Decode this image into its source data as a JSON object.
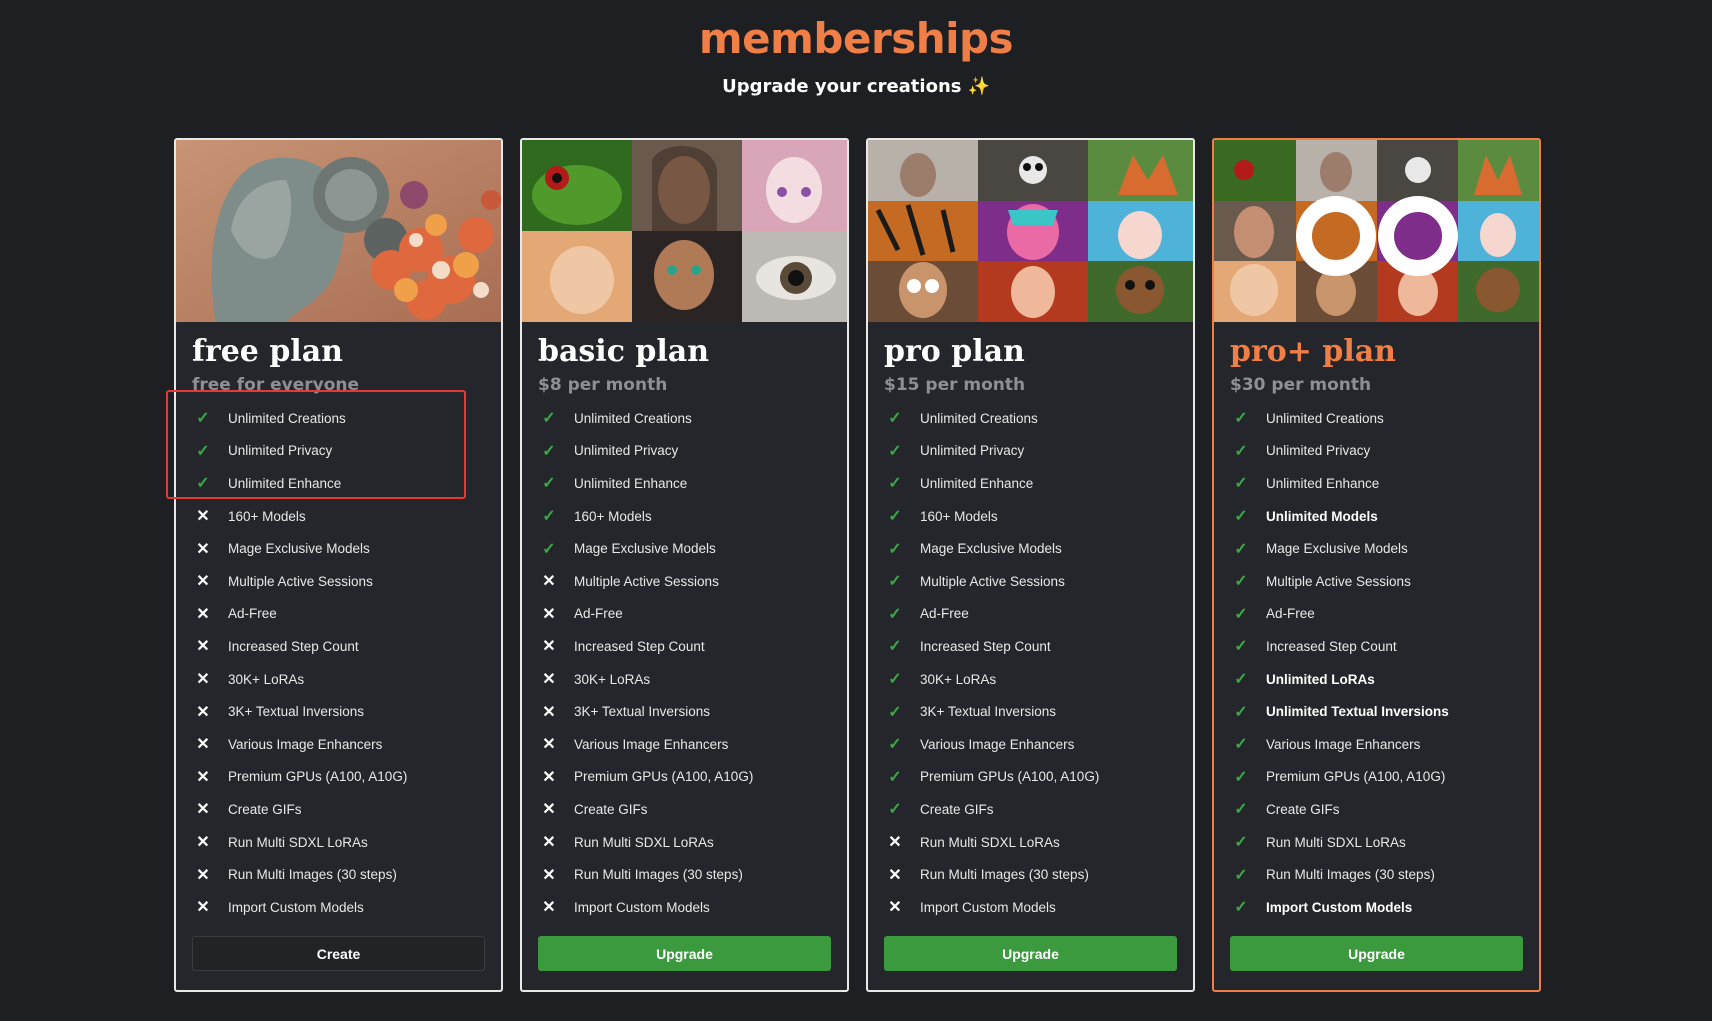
{
  "header": {
    "title": "memberships",
    "subtitle": "Upgrade your creations",
    "sparkle": "✨"
  },
  "colors": {
    "accent": "#ef7f47",
    "check": "#3aa846",
    "button_green": "#3c9a3e",
    "background": "#1e1f22",
    "card": "#25262b",
    "annotation": "#e53935"
  },
  "icons": {
    "check": "check-icon",
    "cross": "x-icon"
  },
  "plans": [
    {
      "name": "free plan",
      "price": "free for everyone",
      "button": "Create",
      "features": [
        {
          "label": "Unlimited Creations",
          "included": true,
          "bold": false
        },
        {
          "label": "Unlimited Privacy",
          "included": true,
          "bold": false
        },
        {
          "label": "Unlimited Enhance",
          "included": true,
          "bold": false
        },
        {
          "label": "160+ Models",
          "included": false,
          "bold": false
        },
        {
          "label": "Mage Exclusive Models",
          "included": false,
          "bold": false
        },
        {
          "label": "Multiple Active Sessions",
          "included": false,
          "bold": false
        },
        {
          "label": "Ad-Free",
          "included": false,
          "bold": false
        },
        {
          "label": "Increased Step Count",
          "included": false,
          "bold": false
        },
        {
          "label": "30K+ LoRAs",
          "included": false,
          "bold": false
        },
        {
          "label": "3K+ Textual Inversions",
          "included": false,
          "bold": false
        },
        {
          "label": "Various Image Enhancers",
          "included": false,
          "bold": false
        },
        {
          "label": "Premium GPUs (A100, A10G)",
          "included": false,
          "bold": false
        },
        {
          "label": "Create GIFs",
          "included": false,
          "bold": false
        },
        {
          "label": "Run Multi SDXL LoRAs",
          "included": false,
          "bold": false
        },
        {
          "label": "Run Multi Images (30 steps)",
          "included": false,
          "bold": false
        },
        {
          "label": "Import Custom Models",
          "included": false,
          "bold": false
        }
      ]
    },
    {
      "name": "basic plan",
      "price": "$8 per month",
      "button": "Upgrade",
      "features": [
        {
          "label": "Unlimited Creations",
          "included": true,
          "bold": false
        },
        {
          "label": "Unlimited Privacy",
          "included": true,
          "bold": false
        },
        {
          "label": "Unlimited Enhance",
          "included": true,
          "bold": false
        },
        {
          "label": "160+ Models",
          "included": true,
          "bold": false
        },
        {
          "label": "Mage Exclusive Models",
          "included": true,
          "bold": false
        },
        {
          "label": "Multiple Active Sessions",
          "included": false,
          "bold": false
        },
        {
          "label": "Ad-Free",
          "included": false,
          "bold": false
        },
        {
          "label": "Increased Step Count",
          "included": false,
          "bold": false
        },
        {
          "label": "30K+ LoRAs",
          "included": false,
          "bold": false
        },
        {
          "label": "3K+ Textual Inversions",
          "included": false,
          "bold": false
        },
        {
          "label": "Various Image Enhancers",
          "included": false,
          "bold": false
        },
        {
          "label": "Premium GPUs (A100, A10G)",
          "included": false,
          "bold": false
        },
        {
          "label": "Create GIFs",
          "included": false,
          "bold": false
        },
        {
          "label": "Run Multi SDXL LoRAs",
          "included": false,
          "bold": false
        },
        {
          "label": "Run Multi Images (30 steps)",
          "included": false,
          "bold": false
        },
        {
          "label": "Import Custom Models",
          "included": false,
          "bold": false
        }
      ]
    },
    {
      "name": "pro plan",
      "price": "$15 per month",
      "button": "Upgrade",
      "features": [
        {
          "label": "Unlimited Creations",
          "included": true,
          "bold": false
        },
        {
          "label": "Unlimited Privacy",
          "included": true,
          "bold": false
        },
        {
          "label": "Unlimited Enhance",
          "included": true,
          "bold": false
        },
        {
          "label": "160+ Models",
          "included": true,
          "bold": false
        },
        {
          "label": "Mage Exclusive Models",
          "included": true,
          "bold": false
        },
        {
          "label": "Multiple Active Sessions",
          "included": true,
          "bold": false
        },
        {
          "label": "Ad-Free",
          "included": true,
          "bold": false
        },
        {
          "label": "Increased Step Count",
          "included": true,
          "bold": false
        },
        {
          "label": "30K+ LoRAs",
          "included": true,
          "bold": false
        },
        {
          "label": "3K+ Textual Inversions",
          "included": true,
          "bold": false
        },
        {
          "label": "Various Image Enhancers",
          "included": true,
          "bold": false
        },
        {
          "label": "Premium GPUs (A100, A10G)",
          "included": true,
          "bold": false
        },
        {
          "label": "Create GIFs",
          "included": true,
          "bold": false
        },
        {
          "label": "Run Multi SDXL LoRAs",
          "included": false,
          "bold": false
        },
        {
          "label": "Run Multi Images (30 steps)",
          "included": false,
          "bold": false
        },
        {
          "label": "Import Custom Models",
          "included": false,
          "bold": false
        }
      ]
    },
    {
      "name": "pro+ plan",
      "price": "$30 per month",
      "button": "Upgrade",
      "features": [
        {
          "label": "Unlimited Creations",
          "included": true,
          "bold": false
        },
        {
          "label": "Unlimited Privacy",
          "included": true,
          "bold": false
        },
        {
          "label": "Unlimited Enhance",
          "included": true,
          "bold": false
        },
        {
          "label": "Unlimited Models",
          "included": true,
          "bold": true
        },
        {
          "label": "Mage Exclusive Models",
          "included": true,
          "bold": false
        },
        {
          "label": "Multiple Active Sessions",
          "included": true,
          "bold": false
        },
        {
          "label": "Ad-Free",
          "included": true,
          "bold": false
        },
        {
          "label": "Increased Step Count",
          "included": true,
          "bold": false
        },
        {
          "label": "Unlimited LoRAs",
          "included": true,
          "bold": true
        },
        {
          "label": "Unlimited Textual Inversions",
          "included": true,
          "bold": true
        },
        {
          "label": "Various Image Enhancers",
          "included": true,
          "bold": false
        },
        {
          "label": "Premium GPUs (A100, A10G)",
          "included": true,
          "bold": false
        },
        {
          "label": "Create GIFs",
          "included": true,
          "bold": false
        },
        {
          "label": "Run Multi SDXL LoRAs",
          "included": true,
          "bold": false
        },
        {
          "label": "Run Multi Images (30 steps)",
          "included": true,
          "bold": false
        },
        {
          "label": "Import Custom Models",
          "included": true,
          "bold": true
        }
      ]
    }
  ]
}
